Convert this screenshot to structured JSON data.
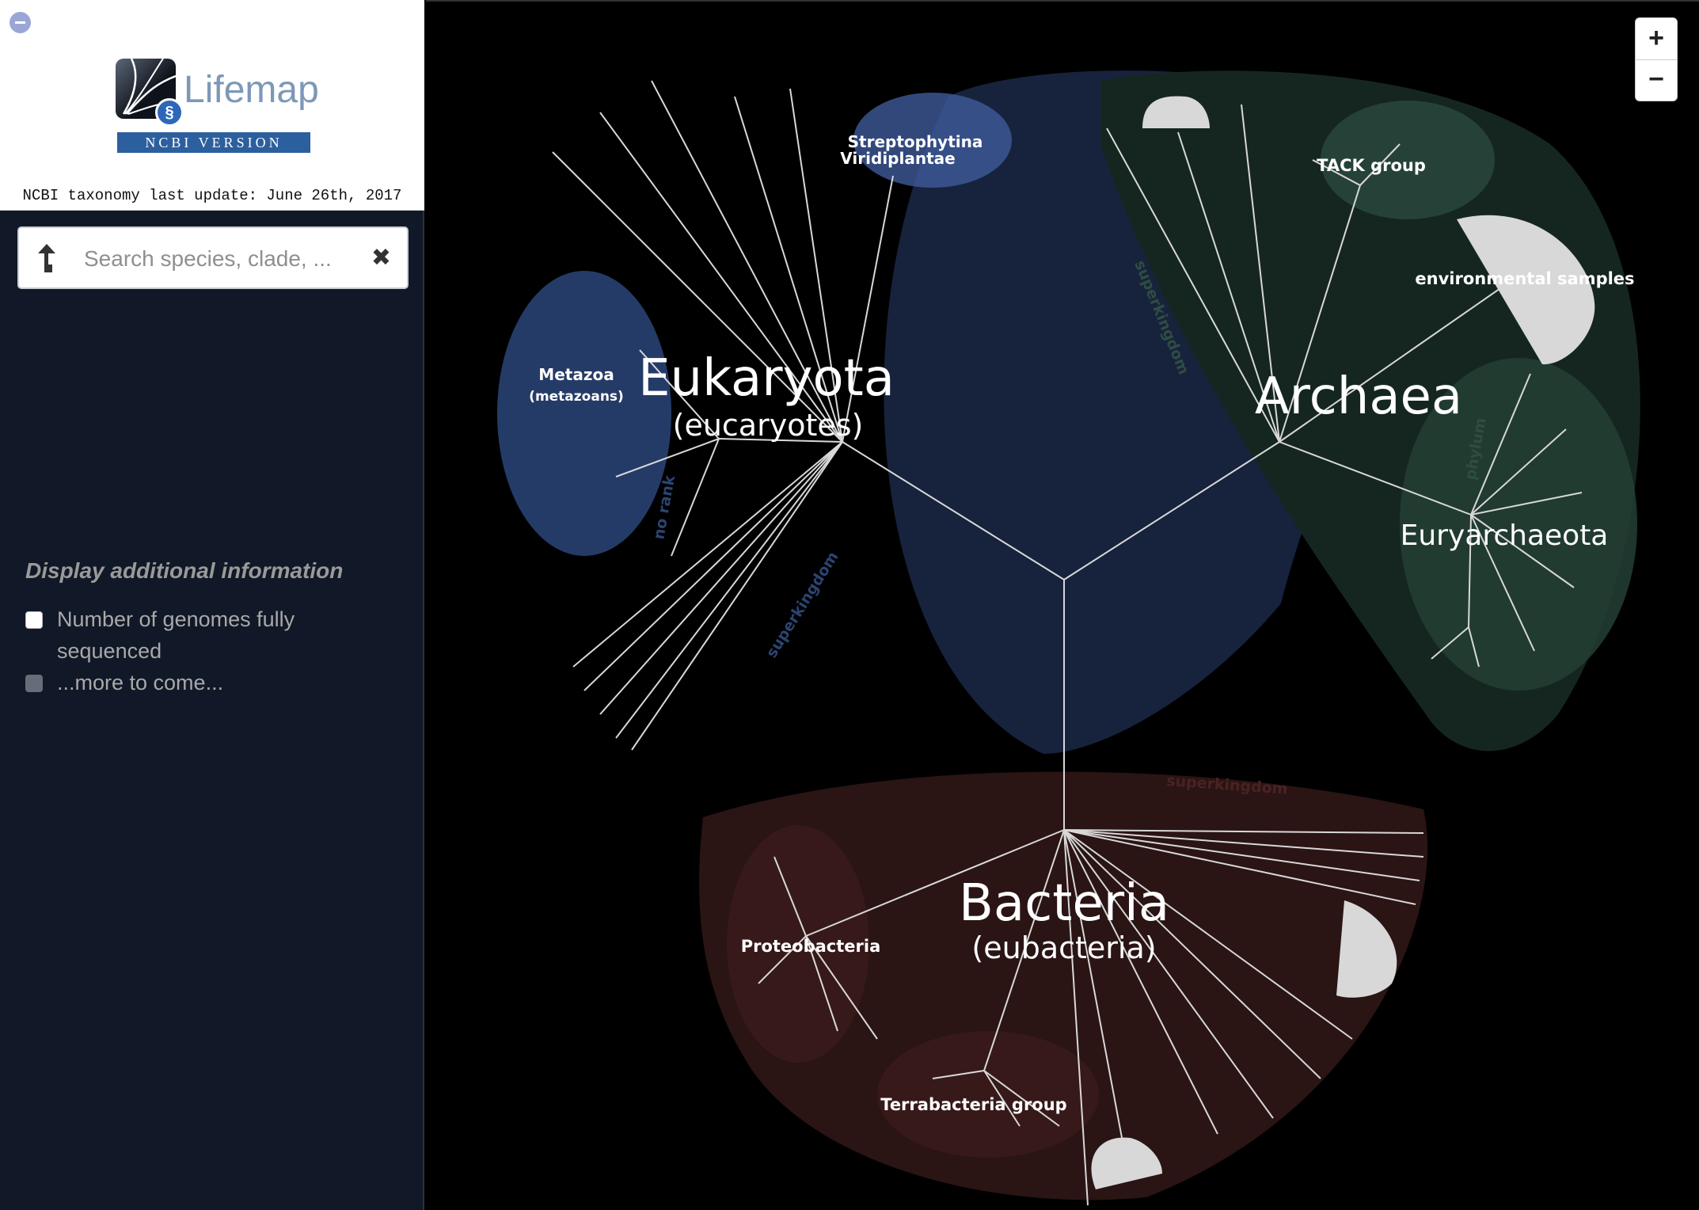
{
  "sidebar": {
    "app_name": "Lifemap",
    "version_label": "NCBI VERSION",
    "update_note": "NCBI taxonomy last update: June 26th, 2017",
    "search": {
      "placeholder": "Search species, clade, ...",
      "value": ""
    },
    "additional_info": {
      "heading": "Display additional information",
      "options": [
        {
          "label": "Number of genomes fully sequenced",
          "checked": false,
          "enabled": true
        },
        {
          "label": "...more to come...",
          "checked": false,
          "enabled": false
        }
      ]
    },
    "icons": {
      "collapse": "collapse-icon",
      "search_up": "up-arrow-icon",
      "clear": "close-icon"
    }
  },
  "map": {
    "zoom": {
      "in_label": "+",
      "out_label": "−"
    },
    "labels": {
      "eukaryota": "Eukaryota",
      "eukaryota_common": "(eucaryotes)",
      "archaea": "Archaea",
      "bacteria": "Bacteria",
      "bacteria_common": "(eubacteria)",
      "metazoa": "Metazoa",
      "metazoa_common": "(metazoans)",
      "streptophytina": "Streptophytina",
      "viridiplantae": "Viridiplantae",
      "tack": "TACK group",
      "env_samples": "environmental samples",
      "euryarchaeota": "Euryarchaeota",
      "proteobacteria": "Proteobacteria",
      "terrabacteria": "Terrabacteria group",
      "rank_superkingdom_euk": "superkingdom",
      "rank_superkingdom_arc": "superkingdom",
      "rank_superkingdom_bac": "superkingdom",
      "rank_norank": "no rank",
      "rank_phylum": "phylum"
    },
    "colors": {
      "eukaryota_region": "#17233d",
      "archaea_region": "#152620",
      "bacteria_region": "#2a1414",
      "branch": "#d8d8d8"
    }
  }
}
